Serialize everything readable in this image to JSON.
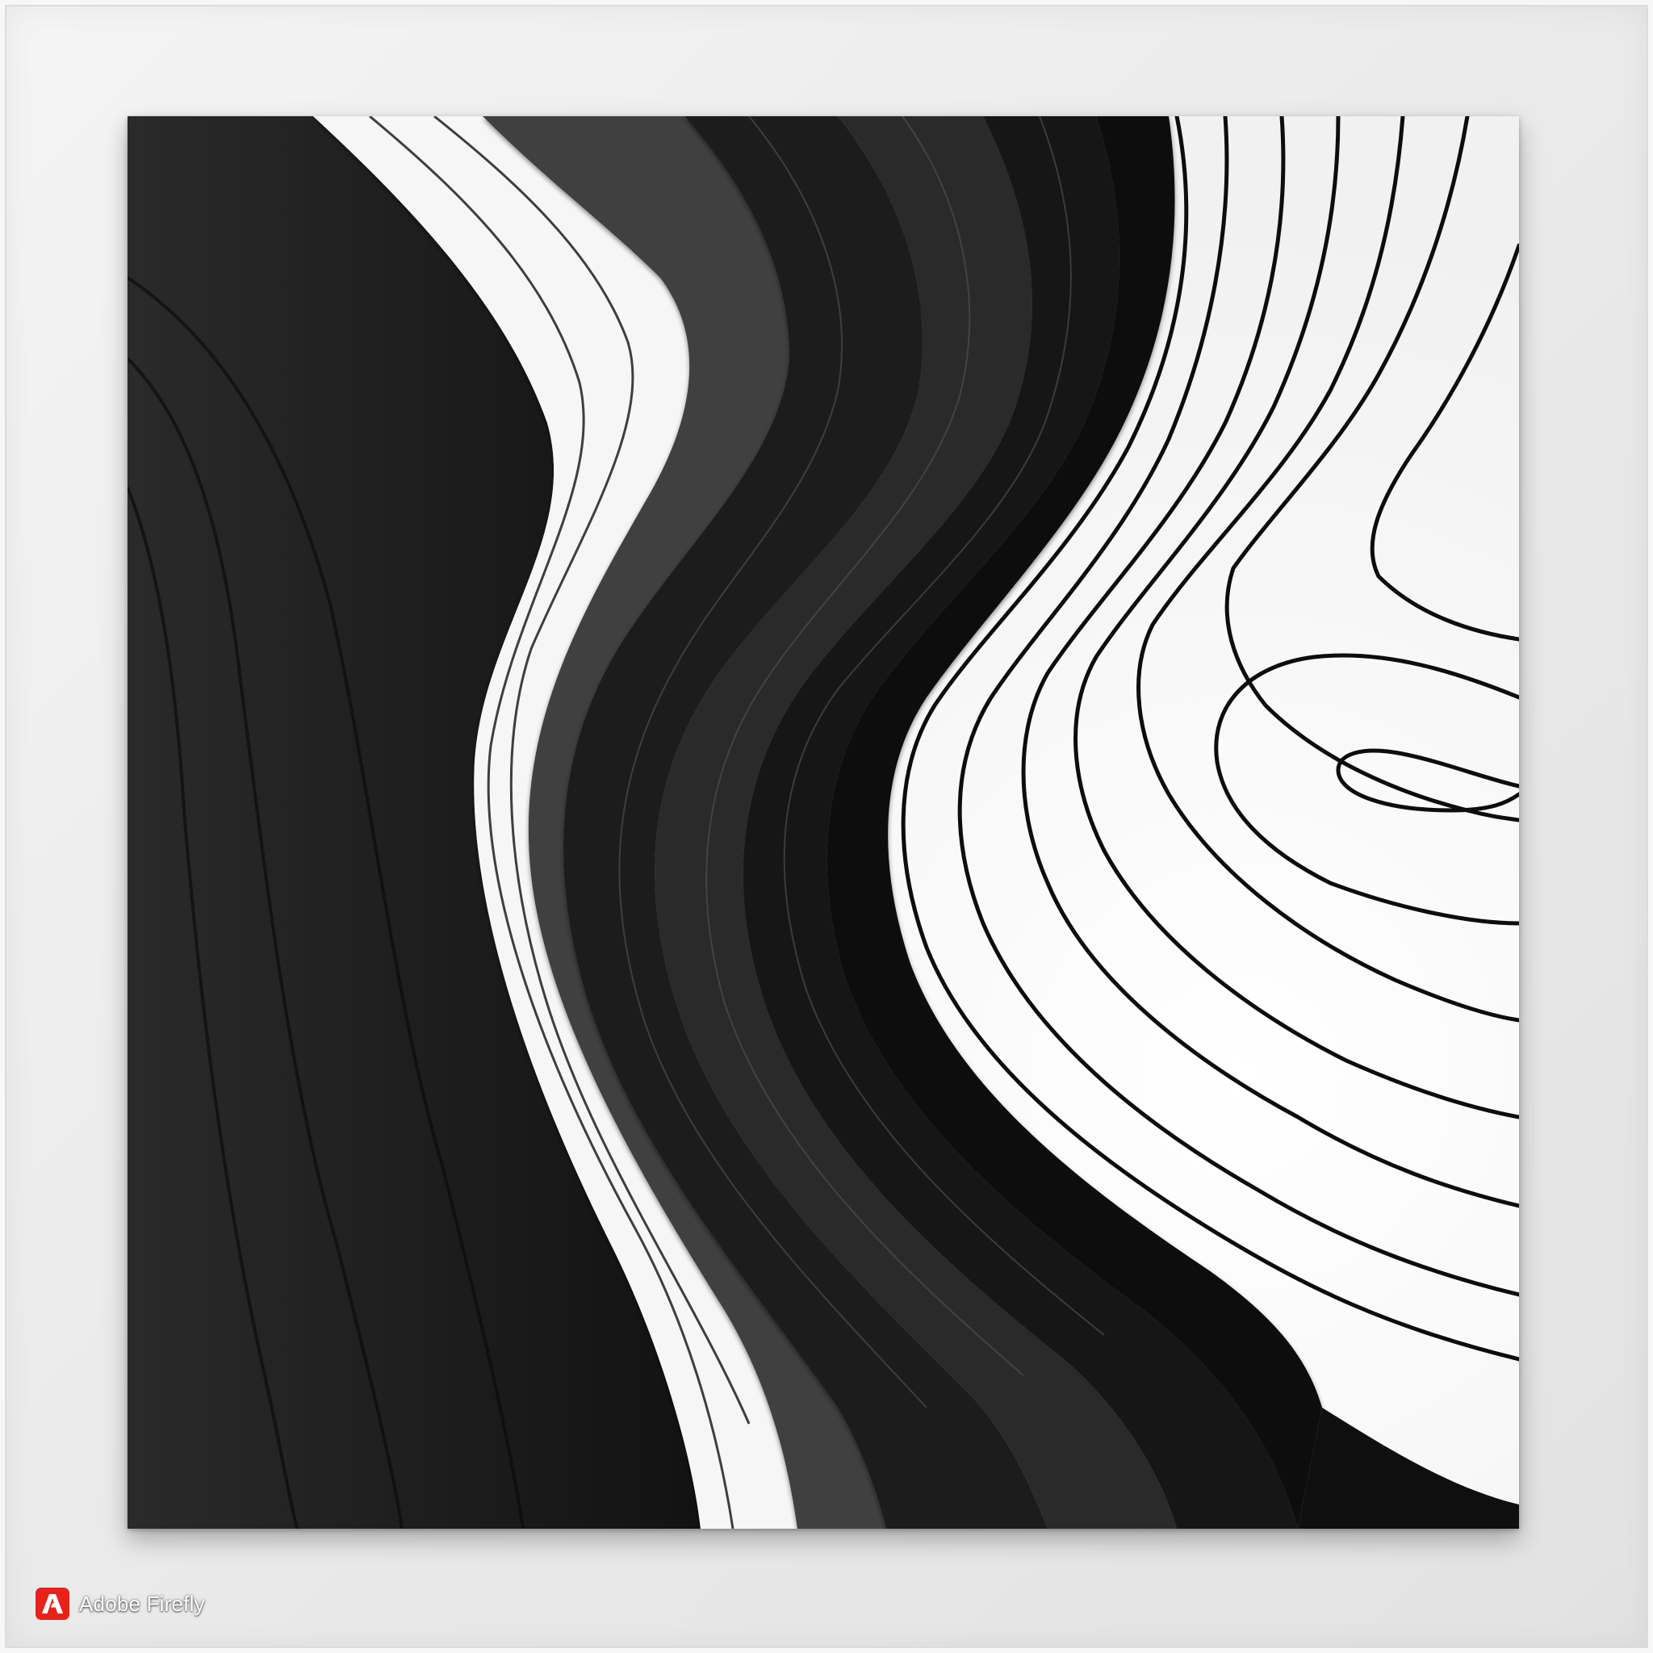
{
  "watermark": {
    "text": "Adobe Firefly",
    "icon": "adobe-logo-icon",
    "color": "#e8221b"
  },
  "palette": {
    "dark": "#1f1f1f",
    "mid": "#3d3d3d",
    "white": "#ffffff",
    "outline": "#0b0b0b"
  }
}
